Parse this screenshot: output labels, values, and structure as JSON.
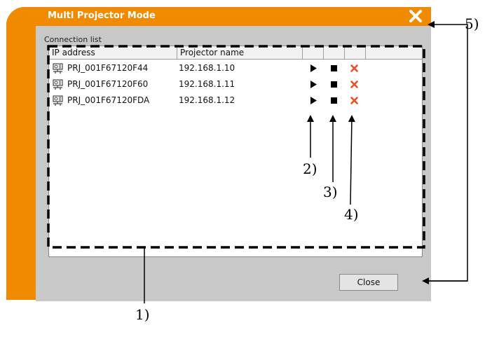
{
  "window": {
    "title": "Multi Projector Mode",
    "accent_color": "#f08a00",
    "close_icon": "close-icon"
  },
  "connection_list": {
    "label": "Connection list",
    "columns": [
      "IP address",
      "Projector name",
      "",
      "",
      ""
    ],
    "rows": [
      {
        "name": "PRJ_001F67120F44",
        "ip": "192.168.1.10",
        "icon": "projector-network-icon"
      },
      {
        "name": "PRJ_001F67120F60",
        "ip": "192.168.1.11",
        "icon": "projector-network-icon"
      },
      {
        "name": "PRJ_001F67120FDA",
        "ip": "192.168.1.12",
        "icon": "projector-network-icon"
      }
    ],
    "row_actions": [
      {
        "icon": "play-icon"
      },
      {
        "icon": "stop-icon"
      },
      {
        "icon": "delete-icon",
        "color": "#e8502a"
      }
    ]
  },
  "buttons": {
    "close_label": "Close"
  },
  "callouts": [
    "1)",
    "2)",
    "3)",
    "4)",
    "5)"
  ]
}
